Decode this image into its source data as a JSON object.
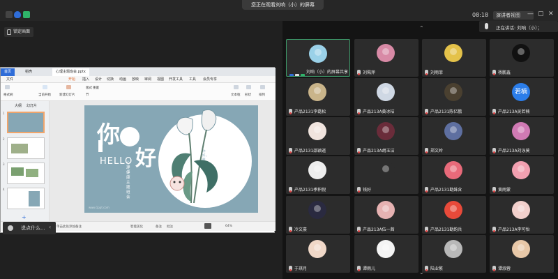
{
  "window": {
    "sharing_banner": "您正在观看刘响（小）的屏幕",
    "clock": "08:18",
    "view_mode": "演讲者视图",
    "controls": [
      "—",
      "▢",
      "✕"
    ]
  },
  "share": {
    "lock_label": "锁定画面",
    "comment_placeholder": "说点什么..."
  },
  "wps": {
    "tabs": [
      "首页",
      "稻壳",
      "心理主题班会.pptx"
    ],
    "menu": [
      "文件",
      "开始",
      "插入",
      "设计",
      "切换",
      "动画",
      "放映",
      "审阅",
      "视图",
      "开发工具",
      "工具",
      "会员专享"
    ],
    "ribbon_items": [
      "格式刷",
      "当前开始",
      "新建幻灯片",
      "版式",
      "节",
      "重置",
      "文本框",
      "形状",
      "排列"
    ],
    "thumbs_tabs": [
      "大纲",
      "幻灯片"
    ],
    "slide_numbers": [
      "1",
      "2",
      "3",
      "4"
    ],
    "status_left": "幻灯片 1 / 10",
    "status_note": "单击此处添加备注",
    "status_right": [
      "智能美化",
      "备注",
      "批注"
    ],
    "zoom": "64%",
    "watermark": "www.1ppt.com"
  },
  "slide": {
    "char1": "你",
    "char2": "好",
    "hello": "HELLO",
    "vertical_title": "心理健康主题班会",
    "vertical_small": "你好，朋友"
  },
  "speaking": {
    "label": "正在讲话: 刘响（小）；"
  },
  "participants": [
    {
      "name": "刘响（小）的屏幕共享",
      "host": true,
      "avatar_color": "#9ad1e8",
      "active": true
    },
    {
      "name": "刘珮萍",
      "avatar_color": "#d88aa6"
    },
    {
      "name": "刘雨菲",
      "avatar_color": "#e4c24a"
    },
    {
      "name": "杨鹏鑫",
      "avatar_color": "#111111"
    },
    {
      "name": "产品2131李磊松",
      "avatar_color": "#c9b48a"
    },
    {
      "name": "产品213A黄冰桔",
      "avatar_color": "#cfd8e4"
    },
    {
      "name": "产品2131陈亿鹏",
      "avatar_color": "#4a4030"
    },
    {
      "name": "产品213A吴若楠",
      "avatar_text": "若楠",
      "avatar_color": "#2b7de9"
    },
    {
      "name": "产品2131邵颖遥",
      "avatar_color": "#f0e4de"
    },
    {
      "name": "产品213A胡玉洁",
      "avatar_color": "#6a2c3a"
    },
    {
      "name": "郑文岭",
      "avatar_color": "#5e6fa0"
    },
    {
      "name": "产品213A刘泳莫",
      "avatar_color": "#d07ab4"
    },
    {
      "name": "产品2131季积倪",
      "avatar_color": "#eeeeee"
    },
    {
      "name": "钱好",
      "avatar_color": "#2c2c2c"
    },
    {
      "name": "产品2131勘姝含",
      "avatar_color": "#e86a7a"
    },
    {
      "name": "黄雨蒙",
      "avatar_color": "#f2a0b0"
    },
    {
      "name": "冷文豪",
      "avatar_color": "#2a2a40"
    },
    {
      "name": "产品213A伍一茜",
      "avatar_color": "#e6b2b2"
    },
    {
      "name": "产品2131勘韵兵",
      "avatar_color": "#e84a3a"
    },
    {
      "name": "产品213A李可怡",
      "avatar_color": "#f2d0cc"
    },
    {
      "name": "于琪月",
      "avatar_color": "#f0d8c8"
    },
    {
      "name": "谭雨儿",
      "avatar_color": "#f4f4f4"
    },
    {
      "name": "陆业繁",
      "avatar_color": "#b8b8b8"
    },
    {
      "name": "谭淑蓉",
      "avatar_color": "#e8c8a8"
    }
  ]
}
